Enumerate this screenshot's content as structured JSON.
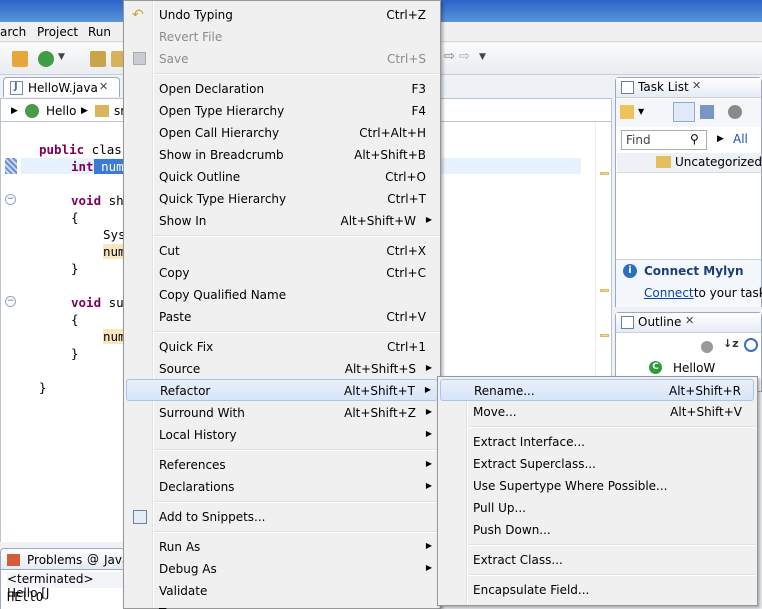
{
  "menubar": {
    "search": "arch",
    "project": "Project",
    "run": "Run"
  },
  "editor": {
    "tab_label": "HelloW.java",
    "breadcrumb": {
      "class": "Hello",
      "next": "sr"
    },
    "code": {
      "l1_kw": "public",
      "l1_rest": " clas",
      "l2_kw": "int",
      "l2_sel": " num",
      "l3_kw": "void",
      "l3_rest": " sh",
      "l4": "{",
      "l5": "Sys",
      "l6": "num",
      "l7": "}",
      "l8_kw": "void",
      "l8_rest": " su",
      "l9": "{",
      "l10": "num",
      "l11": "}",
      "l12": "}"
    }
  },
  "task_list": {
    "title": "Task List",
    "find_placeholder": "Find",
    "all_label": "All",
    "category": "Uncategorized",
    "mylyn_title": "Connect Mylyn",
    "mylyn_link": "Connect",
    "mylyn_text": " to your task a"
  },
  "outline": {
    "title": "Outline",
    "item": "HelloW"
  },
  "console": {
    "problems_tab": "Problems",
    "java_tab": "Java",
    "terminated": "<terminated> Hello [J",
    "output": "HEllO"
  },
  "context_menu": {
    "undo_typing": {
      "label": "Undo Typing",
      "shortcut": "Ctrl+Z"
    },
    "revert_file": {
      "label": "Revert File"
    },
    "save": {
      "label": "Save",
      "shortcut": "Ctrl+S"
    },
    "open_declaration": {
      "label": "Open Declaration",
      "shortcut": "F3"
    },
    "open_type_hierarchy": {
      "label": "Open Type Hierarchy",
      "shortcut": "F4"
    },
    "open_call_hierarchy": {
      "label": "Open Call Hierarchy",
      "shortcut": "Ctrl+Alt+H"
    },
    "show_in_breadcrumb": {
      "label": "Show in Breadcrumb",
      "shortcut": "Alt+Shift+B"
    },
    "quick_outline": {
      "label": "Quick Outline",
      "shortcut": "Ctrl+O"
    },
    "quick_type_hierarchy": {
      "label": "Quick Type Hierarchy",
      "shortcut": "Ctrl+T"
    },
    "show_in": {
      "label": "Show In",
      "shortcut": "Alt+Shift+W"
    },
    "cut": {
      "label": "Cut",
      "shortcut": "Ctrl+X"
    },
    "copy": {
      "label": "Copy",
      "shortcut": "Ctrl+C"
    },
    "copy_qualified_name": {
      "label": "Copy Qualified Name"
    },
    "paste": {
      "label": "Paste",
      "shortcut": "Ctrl+V"
    },
    "quick_fix": {
      "label": "Quick Fix",
      "shortcut": "Ctrl+1"
    },
    "source": {
      "label": "Source",
      "shortcut": "Alt+Shift+S"
    },
    "refactor": {
      "label": "Refactor",
      "shortcut": "Alt+Shift+T"
    },
    "surround_with": {
      "label": "Surround With",
      "shortcut": "Alt+Shift+Z"
    },
    "local_history": {
      "label": "Local History"
    },
    "references": {
      "label": "References"
    },
    "declarations": {
      "label": "Declarations"
    },
    "add_to_snippets": {
      "label": "Add to Snippets..."
    },
    "run_as": {
      "label": "Run As"
    },
    "debug_as": {
      "label": "Debug As"
    },
    "validate": {
      "label": "Validate"
    },
    "team": {
      "label": "T"
    }
  },
  "refactor_menu": {
    "rename": {
      "label": "Rename...",
      "shortcut": "Alt+Shift+R"
    },
    "move": {
      "label": "Move...",
      "shortcut": "Alt+Shift+V"
    },
    "extract_interface": {
      "label": "Extract Interface..."
    },
    "extract_superclass": {
      "label": "Extract Superclass..."
    },
    "use_supertype": {
      "label": "Use Supertype Where Possible..."
    },
    "pull_up": {
      "label": "Pull Up..."
    },
    "push_down": {
      "label": "Push Down..."
    },
    "extract_class": {
      "label": "Extract Class..."
    },
    "encapsulate_field": {
      "label": "Encapsulate Field..."
    }
  },
  "colors": {
    "selection": "#d7e5f8",
    "keyword": "#7f0055",
    "link": "#0645ad",
    "menu_bg": "#f0f0f0"
  }
}
